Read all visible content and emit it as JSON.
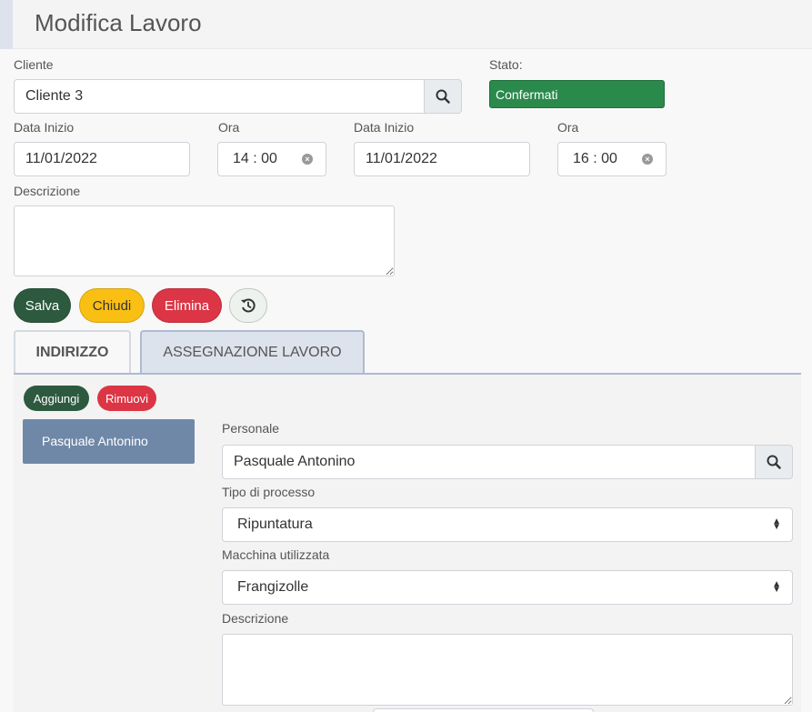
{
  "header": {
    "title": "Modifica Lavoro"
  },
  "form": {
    "cliente_label": "Cliente",
    "cliente_value": "Cliente 3",
    "stato_label": "Stato:",
    "stato_value": "Confermati",
    "data_inizio_label": "Data Inizio",
    "data_inizio_value": "11/01/2022",
    "ora_label": "Ora",
    "ora_value": "14 : 00",
    "data_fine_label": "Data Inizio",
    "data_fine_value": "11/01/2022",
    "ora_fine_label": "Ora",
    "ora_fine_value": "16 : 00",
    "descrizione_label": "Descrizione"
  },
  "actions": {
    "salva": "Salva",
    "chiudi": "Chiudi",
    "elimina": "Elimina"
  },
  "tabs": [
    {
      "label": "INDIRIZZO"
    },
    {
      "label": "ASSEGNAZIONE LAVORO"
    }
  ],
  "assignment": {
    "aggiungi": "Aggiungi",
    "rimuovi": "Rimuovi",
    "list": [
      {
        "label": "Pasquale Antonino"
      }
    ],
    "personale_label": "Personale",
    "personale_value": "Pasquale Antonino",
    "tipo_label": "Tipo di processo",
    "tipo_value": "Ripuntatura",
    "macchina_label": "Macchina utilizzata",
    "macchina_value": "Frangizolle",
    "descrizione_label": "Descrizione"
  },
  "colors": {
    "confermati": "#2a8a4c",
    "salva": "#2d5a3f",
    "chiudi": "#f9bf12",
    "elimina": "#dc3545",
    "list_item": "#6f88a8"
  },
  "icons": [
    "search-icon",
    "clear-icon",
    "history-icon",
    "resize-icon",
    "select-arrows-icon"
  ]
}
